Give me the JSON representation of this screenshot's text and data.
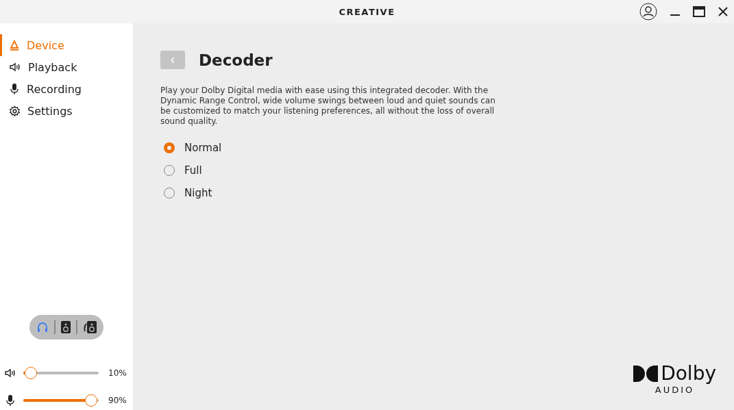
{
  "window": {
    "logo": "CREATIVE"
  },
  "sidebar": {
    "items": [
      {
        "label": "Device",
        "kind": "device",
        "selected": true
      },
      {
        "label": "Playback",
        "kind": "speaker",
        "selected": false
      },
      {
        "label": "Recording",
        "kind": "mic",
        "selected": false
      },
      {
        "label": "Settings",
        "kind": "gear",
        "selected": false
      }
    ],
    "outputs": [
      {
        "kind": "headphones",
        "selected": true
      },
      {
        "kind": "speaker",
        "selected": false
      },
      {
        "kind": "both",
        "selected": false
      }
    ],
    "sliders": [
      {
        "kind": "speaker",
        "level": 0.1,
        "reading": "10%"
      },
      {
        "kind": "mic",
        "level": 0.9,
        "reading": "90%"
      }
    ]
  },
  "main": {
    "title": "Decoder",
    "description": "Play your Dolby Digital media with ease using this integrated decoder. With the Dynamic Range Control, wide volume swings between loud and quiet sounds can be customized to match your listening preferences, all without the loss of overall sound quality.",
    "options": [
      {
        "label": "Normal",
        "selected": true
      },
      {
        "label": "Full",
        "selected": false
      },
      {
        "label": "Night",
        "selected": false
      }
    ],
    "brand": {
      "name": "Dolby",
      "sub": "AUDIO"
    }
  }
}
